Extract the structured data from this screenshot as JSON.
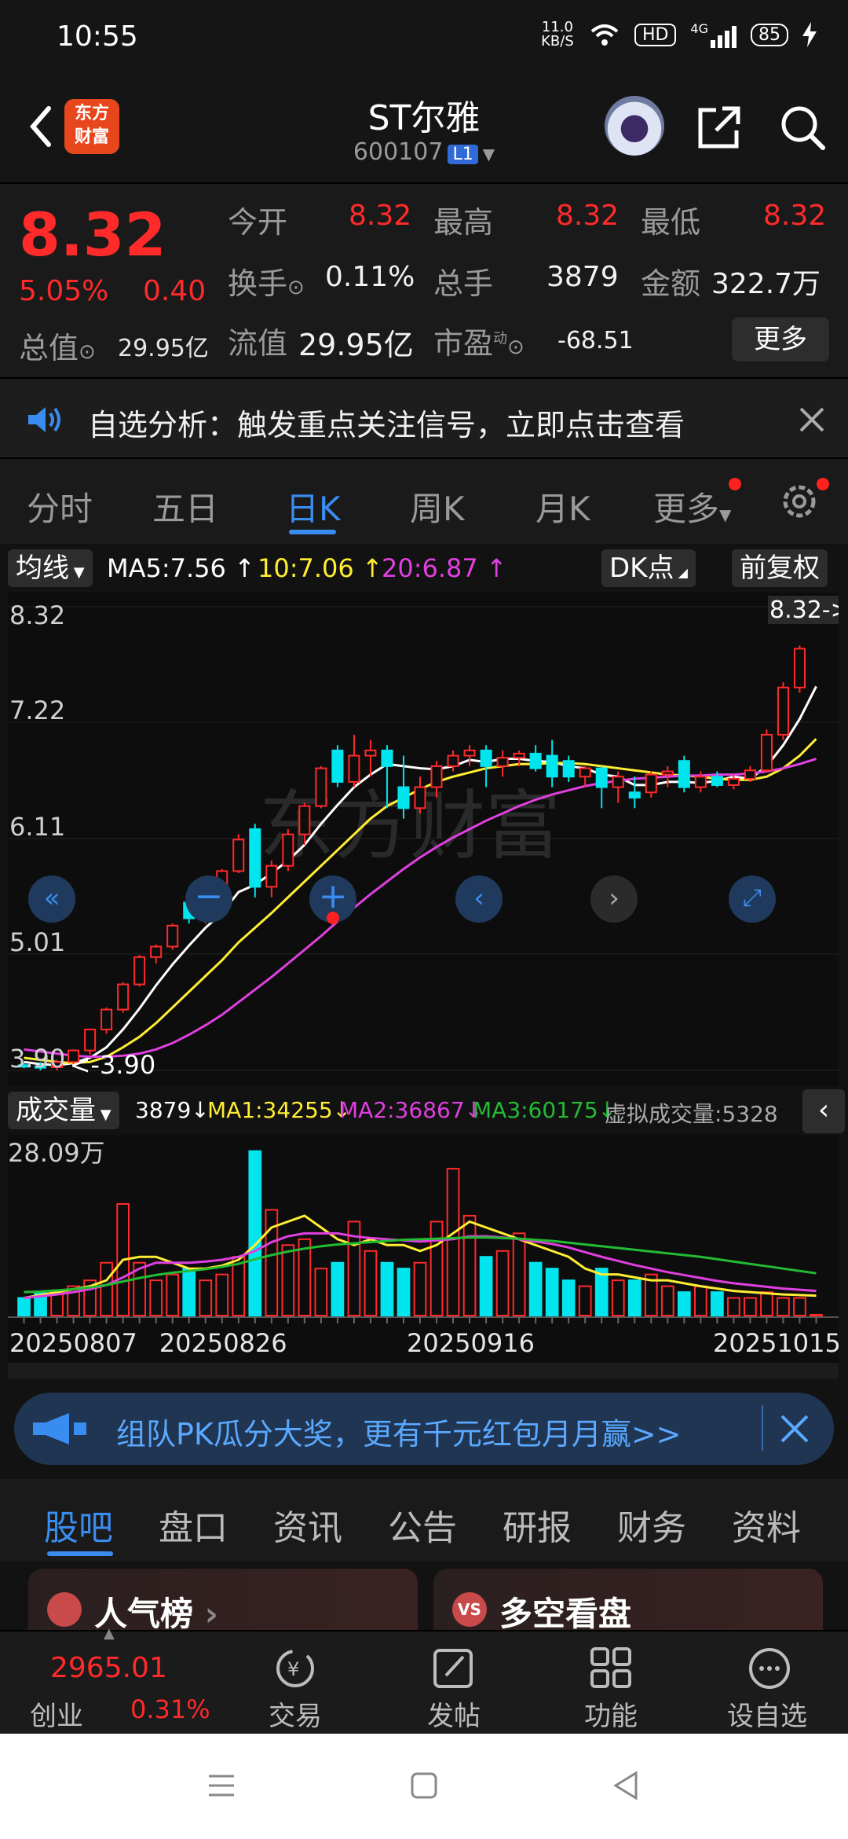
{
  "status_bar": {
    "time": "10:55",
    "speed": "11.0 KB/S",
    "hd": "HD",
    "network": "4G",
    "battery": "85"
  },
  "header": {
    "name": "ST尔雅",
    "code": "600107",
    "level_badge": "L1",
    "logo_line1": "东方",
    "logo_line2": "财富"
  },
  "quote": {
    "price": "8.32",
    "change_pct": "5.05%",
    "change": "0.40",
    "market_cap_label": "总值",
    "market_cap": "29.95亿",
    "open_label": "今开",
    "open": "8.32",
    "high_label": "最高",
    "high": "8.32",
    "low_label": "最低",
    "low": "8.32",
    "turnover_label": "换手",
    "turnover": "0.11%",
    "volume_label": "总手",
    "volume": "3879",
    "amount_label": "金额",
    "amount": "322.7万",
    "float_cap_label": "流值",
    "float_cap": "29.95亿",
    "pe_label": "市盈",
    "pe_sup": "动",
    "pe": "-68.51",
    "more": "更多"
  },
  "alert": {
    "text": "自选分析：触发重点关注信号，立即点击查看"
  },
  "period_tabs": [
    "分时",
    "五日",
    "日K",
    "周K",
    "月K",
    "更多"
  ],
  "active_period": "日K",
  "ma_bar": {
    "chip": "均线",
    "ma5": "MA5:7.56",
    "ma10": "10:7.06",
    "ma20": "20:6.87",
    "dk": "DK点",
    "adjust": "前复权"
  },
  "colors": {
    "up": "#ff2a2a",
    "down": "#00e5ee",
    "ma5": "#ffffff",
    "ma10": "#ffee33",
    "ma20": "#e040e0",
    "accent": "#3a8df0"
  },
  "chart_data": {
    "type": "candlestick",
    "y_ticks": [
      "8.32",
      "7.22",
      "6.11",
      "5.01",
      "3.90"
    ],
    "ylim": [
      3.9,
      8.32
    ],
    "last_price_tag": "8.32->",
    "low_marker": "<-3.90",
    "candles": [
      [
        3.95,
        3.97,
        3.92,
        3.94
      ],
      [
        3.94,
        3.98,
        3.9,
        3.93
      ],
      [
        3.93,
        4.0,
        3.9,
        3.98
      ],
      [
        3.98,
        4.1,
        3.96,
        4.09
      ],
      [
        4.09,
        4.3,
        4.05,
        4.29
      ],
      [
        4.29,
        4.5,
        4.25,
        4.48
      ],
      [
        4.48,
        4.74,
        4.45,
        4.72
      ],
      [
        4.72,
        5.0,
        4.7,
        4.98
      ],
      [
        4.98,
        5.1,
        4.92,
        5.08
      ],
      [
        5.08,
        5.3,
        5.05,
        5.28
      ],
      [
        5.5,
        5.6,
        5.3,
        5.35
      ],
      [
        5.35,
        5.55,
        5.3,
        5.52
      ],
      [
        5.52,
        5.82,
        5.48,
        5.8
      ],
      [
        5.8,
        6.15,
        5.78,
        6.1
      ],
      [
        6.2,
        6.25,
        5.55,
        5.65
      ],
      [
        5.65,
        5.9,
        5.55,
        5.85
      ],
      [
        5.85,
        6.2,
        5.8,
        6.15
      ],
      [
        6.15,
        6.45,
        6.05,
        6.42
      ],
      [
        6.42,
        6.8,
        6.4,
        6.78
      ],
      [
        6.95,
        7.0,
        6.6,
        6.65
      ],
      [
        6.65,
        7.1,
        6.6,
        6.9
      ],
      [
        6.9,
        7.05,
        6.7,
        6.95
      ],
      [
        6.95,
        7.0,
        6.4,
        6.8
      ],
      [
        6.6,
        6.9,
        6.3,
        6.4
      ],
      [
        6.4,
        6.7,
        6.35,
        6.6
      ],
      [
        6.6,
        6.85,
        6.5,
        6.8
      ],
      [
        6.8,
        6.95,
        6.75,
        6.9
      ],
      [
        6.9,
        7.0,
        6.8,
        6.95
      ],
      [
        6.95,
        7.0,
        6.6,
        6.8
      ],
      [
        6.8,
        6.95,
        6.7,
        6.88
      ],
      [
        6.88,
        6.95,
        6.8,
        6.92
      ],
      [
        6.92,
        7.0,
        6.75,
        6.78
      ],
      [
        6.9,
        7.05,
        6.6,
        6.7
      ],
      [
        6.85,
        6.9,
        6.65,
        6.7
      ],
      [
        6.7,
        6.8,
        6.6,
        6.78
      ],
      [
        6.78,
        6.8,
        6.4,
        6.6
      ],
      [
        6.6,
        6.75,
        6.45,
        6.7
      ],
      [
        6.55,
        6.7,
        6.4,
        6.5
      ],
      [
        6.55,
        6.75,
        6.5,
        6.72
      ],
      [
        6.72,
        6.8,
        6.6,
        6.75
      ],
      [
        6.85,
        6.9,
        6.55,
        6.6
      ],
      [
        6.6,
        6.75,
        6.55,
        6.7
      ],
      [
        6.7,
        6.75,
        6.6,
        6.62
      ],
      [
        6.62,
        6.72,
        6.58,
        6.68
      ],
      [
        6.68,
        6.8,
        6.65,
        6.76
      ],
      [
        6.76,
        7.15,
        6.74,
        7.1
      ],
      [
        7.1,
        7.6,
        7.05,
        7.55
      ],
      [
        7.55,
        7.95,
        7.5,
        7.92
      ],
      [
        8.32,
        8.32,
        8.32,
        8.32
      ]
    ],
    "ma5": [
      3.98,
      3.96,
      3.95,
      3.97,
      4.02,
      4.12,
      4.29,
      4.49,
      4.71,
      4.91,
      5.09,
      5.26,
      5.4,
      5.6,
      5.67,
      5.78,
      5.9,
      6.05,
      6.25,
      6.43,
      6.6,
      6.72,
      6.82,
      6.8,
      6.78,
      6.77,
      6.8,
      6.86,
      6.84,
      6.87,
      6.87,
      6.85,
      6.84,
      6.8,
      6.78,
      6.72,
      6.7,
      6.62,
      6.62,
      6.65,
      6.65,
      6.64,
      6.66,
      6.7,
      6.68,
      6.8,
      7.0,
      7.25,
      7.56
    ],
    "ma10": [
      4.02,
      4.0,
      3.98,
      3.97,
      3.98,
      4.03,
      4.12,
      4.22,
      4.35,
      4.5,
      4.65,
      4.8,
      4.95,
      5.12,
      5.26,
      5.4,
      5.55,
      5.7,
      5.85,
      6.0,
      6.15,
      6.3,
      6.42,
      6.5,
      6.58,
      6.65,
      6.7,
      6.74,
      6.78,
      6.8,
      6.82,
      6.82,
      6.83,
      6.83,
      6.82,
      6.8,
      6.78,
      6.76,
      6.74,
      6.72,
      6.71,
      6.7,
      6.68,
      6.67,
      6.67,
      6.7,
      6.78,
      6.9,
      7.06
    ],
    "ma20": [
      4.1,
      4.08,
      4.06,
      4.04,
      4.03,
      4.03,
      4.04,
      4.06,
      4.1,
      4.16,
      4.24,
      4.33,
      4.43,
      4.55,
      4.67,
      4.79,
      4.92,
      5.05,
      5.18,
      5.32,
      5.45,
      5.58,
      5.7,
      5.82,
      5.93,
      6.03,
      6.12,
      6.2,
      6.28,
      6.35,
      6.42,
      6.48,
      6.53,
      6.57,
      6.61,
      6.64,
      6.66,
      6.68,
      6.69,
      6.7,
      6.71,
      6.71,
      6.72,
      6.72,
      6.73,
      6.75,
      6.78,
      6.82,
      6.87
    ],
    "x_dates": [
      "20250807",
      "20250826",
      "20250916",
      "20251015"
    ]
  },
  "volume_bar": {
    "chip": "成交量",
    "vol": "3879",
    "ma1": "MA1:34255",
    "ma2": "MA2:36867",
    "ma3": "MA3:60175",
    "virtual": "虚拟成交量:5328"
  },
  "volume_data": {
    "max_label": "28.09万",
    "bars": [
      3,
      4,
      4,
      5,
      6,
      9,
      19,
      9,
      6,
      7,
      8,
      6,
      7,
      10,
      28,
      18,
      12,
      13,
      8,
      9,
      16,
      11,
      9,
      8,
      9,
      16,
      25,
      17,
      10,
      11,
      14,
      9,
      8,
      6,
      5,
      8,
      6,
      6,
      7,
      5,
      4,
      5,
      4,
      3,
      3,
      4,
      3,
      3,
      0.14
    ],
    "ma1": [
      3,
      3.5,
      4,
      4.5,
      5,
      6,
      9.5,
      10,
      10,
      9,
      8,
      8,
      8.5,
      9.5,
      12,
      15,
      16,
      17,
      15,
      13,
      12,
      13,
      12,
      12,
      11,
      12,
      14,
      16,
      15,
      14,
      13,
      12,
      11,
      10,
      8,
      7,
      7,
      6.5,
      6,
      6,
      5.5,
      5,
      4.6,
      4.2,
      4,
      3.8,
      3.6,
      3.5,
      3.4
    ],
    "ma2": [
      3,
      3.3,
      3.6,
      4,
      4.5,
      5.2,
      6.5,
      8,
      9,
      9,
      9,
      9.2,
      9.5,
      10,
      11,
      12.5,
      13.5,
      14,
      14,
      14,
      13.5,
      13.2,
      13,
      12.8,
      12.6,
      12.8,
      13,
      13.5,
      13.5,
      13.3,
      13,
      12.6,
      12.2,
      11.6,
      10.8,
      10,
      9.3,
      8.6,
      8,
      7.4,
      6.9,
      6.4,
      5.9,
      5.5,
      5.2,
      4.9,
      4.6,
      4.4,
      4.2
    ],
    "ma3": [
      4,
      4.1,
      4.3,
      4.5,
      4.8,
      5.2,
      5.8,
      6.4,
      6.9,
      7.3,
      7.6,
      7.9,
      8.3,
      8.8,
      9.6,
      10.3,
      10.9,
      11.4,
      11.8,
      12.1,
      12.3,
      12.5,
      12.7,
      12.9,
      13,
      13.1,
      13.2,
      13.3,
      13.3,
      13.2,
      13.1,
      12.9,
      12.7,
      12.4,
      12.1,
      11.8,
      11.5,
      11.2,
      10.9,
      10.6,
      10.3,
      10,
      9.6,
      9.2,
      8.8,
      8.4,
      8,
      7.6,
      7.2
    ]
  },
  "promo": {
    "text": "组队PK瓜分大奖，更有千元红包月月赢>>"
  },
  "content_tabs": [
    "股吧",
    "盘口",
    "资讯",
    "公告",
    "研报",
    "财务",
    "资料"
  ],
  "cards": {
    "left": "人气榜",
    "right": "多空看盘"
  },
  "bottom_nav": {
    "index_value": "2965.01",
    "index_name": "创业",
    "index_pct": "0.31%",
    "trade": "交易",
    "post": "发帖",
    "function": "功能",
    "watchlist": "设自选"
  }
}
